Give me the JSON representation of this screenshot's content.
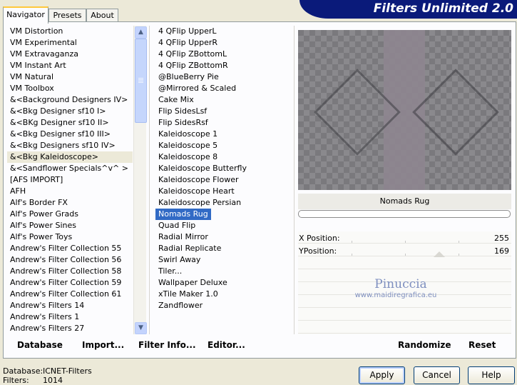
{
  "app": {
    "title": "Filters Unlimited 2.0"
  },
  "tabs": [
    {
      "label": "Navigator",
      "active": true
    },
    {
      "label": "Presets",
      "active": false
    },
    {
      "label": "About",
      "active": false
    }
  ],
  "categories": [
    "VM Distortion",
    "VM Experimental",
    "VM Extravaganza",
    "VM Instant Art",
    "VM Natural",
    "VM Toolbox",
    "&<Background Designers IV>",
    "&<Bkg Designer sf10 I>",
    "&<BKg Designer sf10 II>",
    "&<Bkg Designer sf10 III>",
    "&<Bkg Designers sf10 IV>",
    "&<Bkg Kaleidoscope>",
    "&<Sandflower Specials^v^ >",
    "[AFS IMPORT]",
    "AFH",
    "Alf's Border FX",
    "Alf's Power Grads",
    "Alf's Power Sines",
    "Alf's Power Toys",
    "Andrew's Filter Collection 55",
    "Andrew's Filter Collection 56",
    "Andrew's Filter Collection 58",
    "Andrew's Filter Collection 59",
    "Andrew's Filter Collection 61",
    "Andrew's Filters 14",
    "Andrew's Filters 1",
    "Andrew's Filters 27"
  ],
  "selected_category_index": 11,
  "filters": [
    "4 QFlip UpperL",
    "4 QFlip UpperR",
    "4 QFlip ZBottomL",
    "4 QFlip ZBottomR",
    "@BlueBerry Pie",
    "@Mirrored & Scaled",
    "Cake Mix",
    "Flip SidesLsf",
    "Flip SidesRsf",
    "Kaleidoscope 1",
    "Kaleidoscope 5",
    "Kaleidoscope 8",
    "Kaleidoscope Butterfly",
    "Kaleidoscope Flower",
    "Kaleidoscope Heart",
    "Kaleidoscope Persian",
    "Nomads Rug",
    "Quad Flip",
    "Radial Mirror",
    "Radial Replicate",
    "Swirl Away",
    "Tiler...",
    "Wallpaper Deluxe",
    "xTile Maker 1.0",
    "Zandflower"
  ],
  "selected_filter_index": 16,
  "preview": {
    "filter_name": "Nomads Rug",
    "watermark_line1": "Pinuccia",
    "watermark_line2": "www.maidiregrafica.eu"
  },
  "sliders": [
    {
      "label": "X Position:",
      "value": "255"
    },
    {
      "label": "YPosition:",
      "value": "169"
    }
  ],
  "toolbar": {
    "database": "Database",
    "import": "Import...",
    "filter_info": "Filter Info...",
    "editor": "Editor...",
    "randomize": "Randomize",
    "reset": "Reset"
  },
  "status": {
    "database_label": "Database:",
    "database_value": "ICNET-Filters",
    "filters_label": "Filters:",
    "filters_value": "1014"
  },
  "buttons": {
    "apply": "Apply",
    "cancel": "Cancel",
    "help": "Help"
  }
}
